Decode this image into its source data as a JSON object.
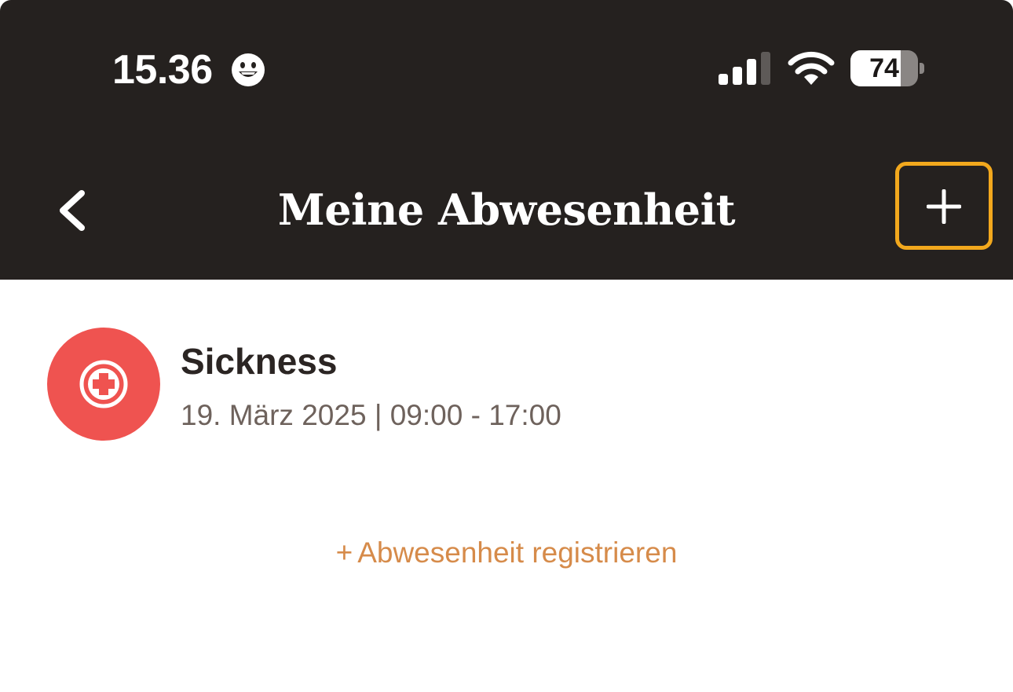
{
  "status_bar": {
    "time": "15.36",
    "battery_level": "74",
    "battery_fraction": 0.74
  },
  "header": {
    "title": "Meine Abwesenheit"
  },
  "absences": [
    {
      "type": "Sickness",
      "date": "19. März 2025",
      "separator": "|",
      "time_range": "09:00 - 17:00",
      "icon": "medical-cross-icon"
    }
  ],
  "register_link": {
    "plus": "+",
    "label": "Abwesenheit registrieren"
  },
  "colors": {
    "header_bg": "#25211f",
    "add_button_highlight": "#f2a81d",
    "sickness_red": "#ef5350",
    "link_orange": "#d68b4a"
  }
}
